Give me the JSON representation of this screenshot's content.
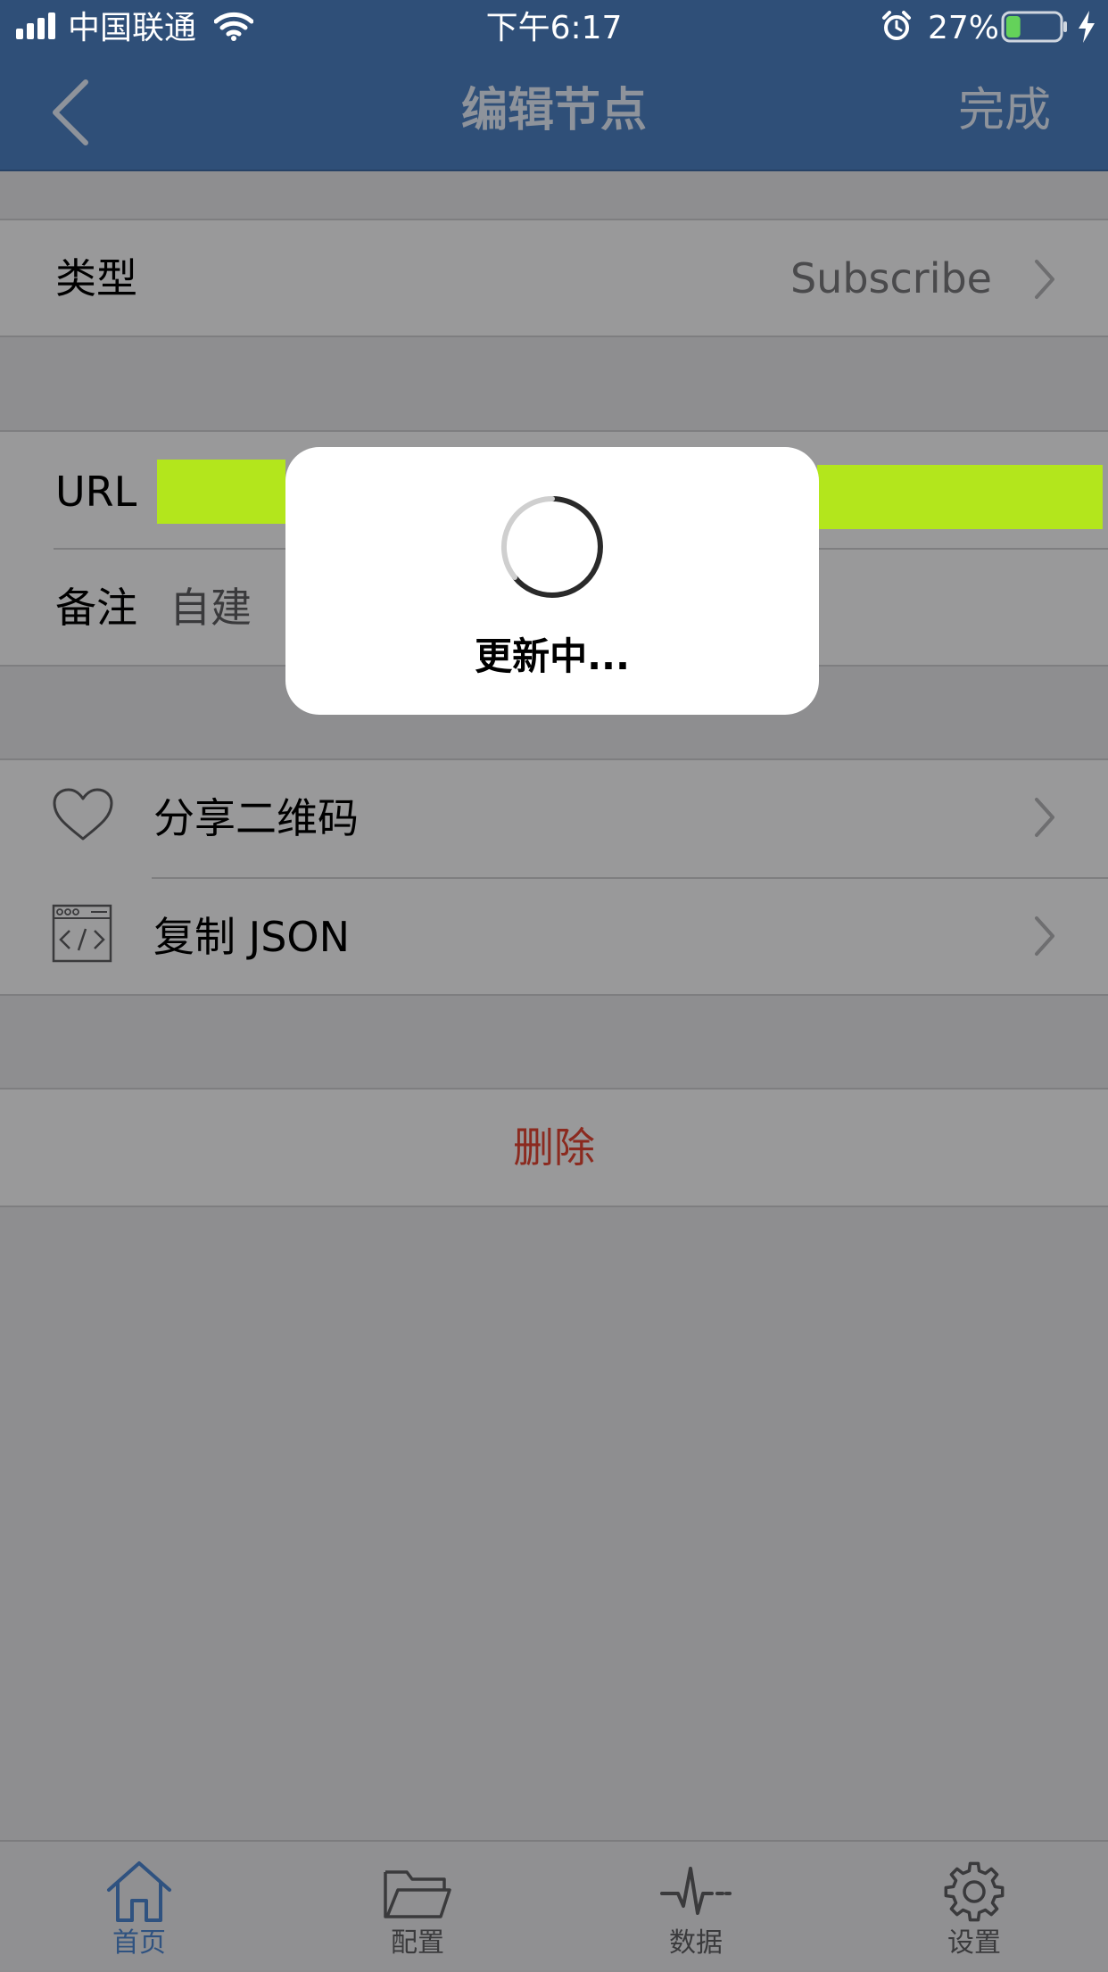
{
  "status_bar": {
    "carrier": "中国联通",
    "time": "下午6:17",
    "battery_percent": "27%",
    "battery_level": 0.27
  },
  "nav": {
    "title": "编辑节点",
    "done_label": "完成"
  },
  "form": {
    "type_label": "类型",
    "type_value": "Subscribe",
    "url_label": "URL",
    "remark_label": "备注",
    "remark_value": "自建"
  },
  "actions": {
    "share_qr_label": "分享二维码",
    "copy_json_label": "复制 JSON",
    "delete_label": "删除"
  },
  "hud": {
    "text": "更新中..."
  },
  "tabs": [
    {
      "label": "首页",
      "icon": "home-icon",
      "active": true
    },
    {
      "label": "配置",
      "icon": "folder-icon",
      "active": false
    },
    {
      "label": "数据",
      "icon": "pulse-icon",
      "active": false
    },
    {
      "label": "设置",
      "icon": "gear-icon",
      "active": false
    }
  ],
  "colors": {
    "nav_background": "#2f4f78",
    "tab_active": "#2f5280",
    "delete_text": "#8b2a1f",
    "url_highlight": "#b3e61c"
  }
}
